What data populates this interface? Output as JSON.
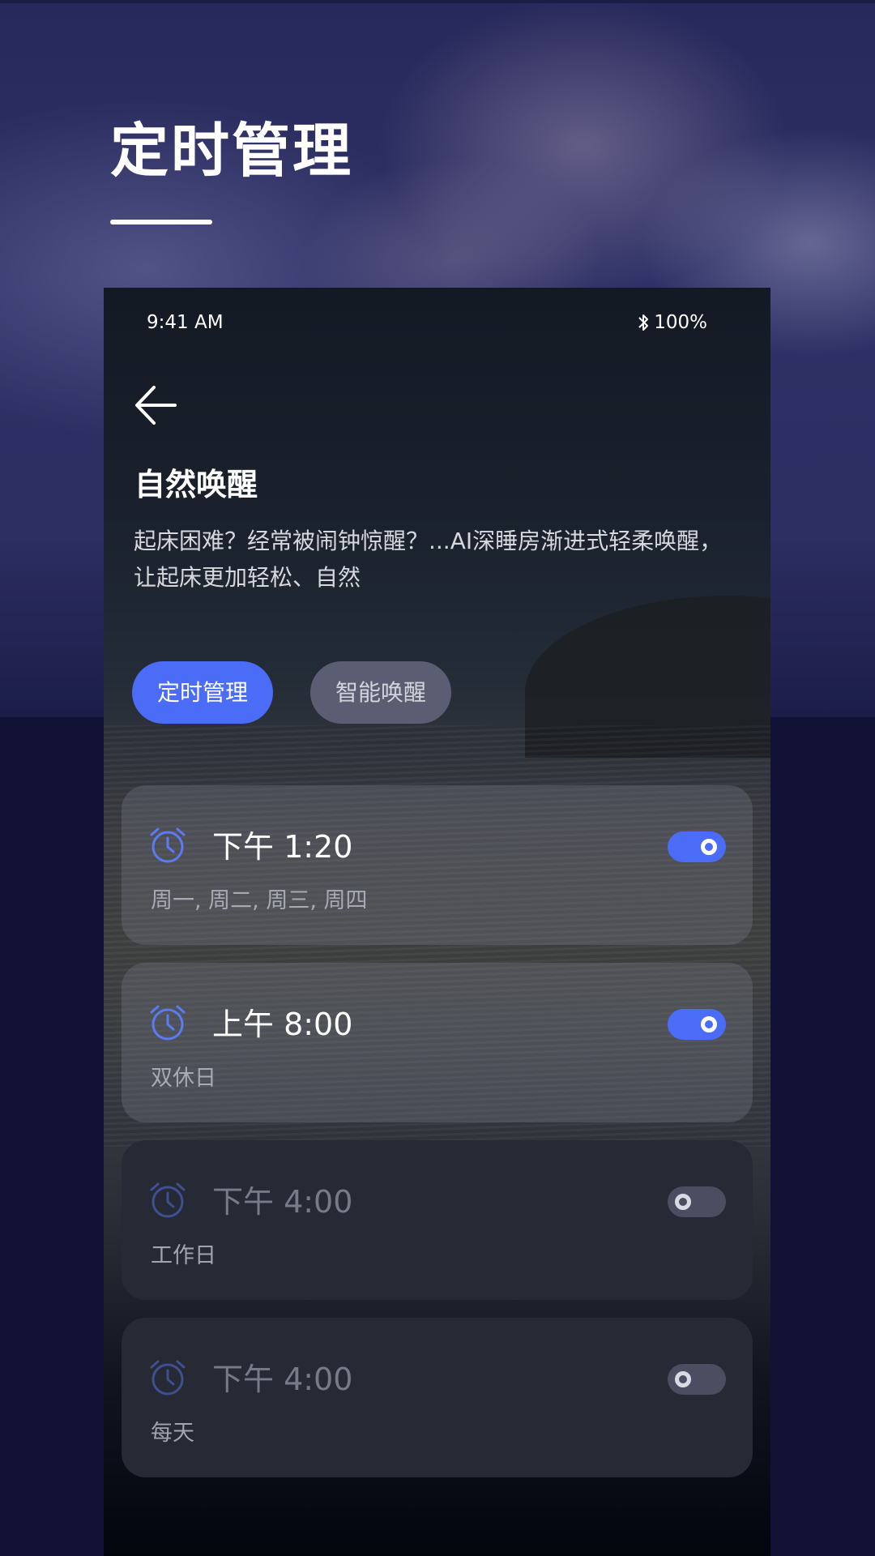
{
  "banner": {
    "title": "定时管理"
  },
  "status_bar": {
    "time": "9:41 AM",
    "battery": "100%"
  },
  "page": {
    "title": "自然唤醒",
    "description": "起床困难？经常被闹钟惊醒？...AI深睡房渐进式轻柔唤醒，让起床更加轻松、自然"
  },
  "tabs": [
    {
      "label": "定时管理",
      "active": true
    },
    {
      "label": "智能唤醒",
      "active": false
    }
  ],
  "alarms": [
    {
      "time": "下午 1:20",
      "days": "周一, 周二, 周三, 周四",
      "enabled": true
    },
    {
      "time": "上午 8:00",
      "days": "双休日",
      "enabled": true
    },
    {
      "time": "下午 4:00",
      "days": "工作日",
      "enabled": false
    },
    {
      "time": "下午 4:00",
      "days": "每天",
      "enabled": false
    }
  ],
  "colors": {
    "accent": "#4a6cf7",
    "toggle_off": "#4a4e60",
    "banner_bg": "#2c2d61",
    "page_bg": "#111235"
  },
  "icons": {
    "back": "arrow-left-icon",
    "bluetooth": "bluetooth-icon",
    "alarm": "alarm-clock-icon"
  }
}
